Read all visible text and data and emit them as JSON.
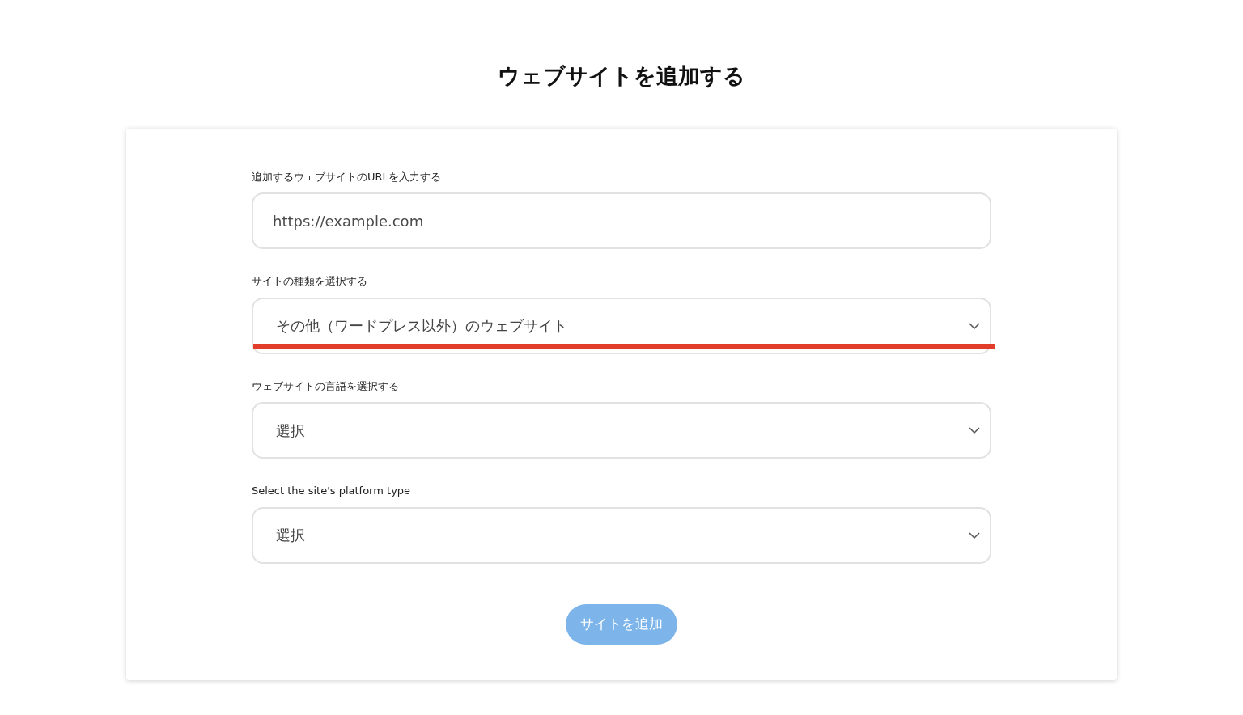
{
  "title": "ウェブサイトを追加する",
  "fields": [
    {
      "kind": "text",
      "label": "追加するウェブサイトのURLを入力する",
      "placeholder": "https://example.com",
      "highlighted": false
    },
    {
      "kind": "select",
      "label": "サイトの種類を選択する",
      "value": "その他（ワードプレス以外）のウェブサイト",
      "highlighted": true
    },
    {
      "kind": "select",
      "label": "ウェブサイトの言語を選択する",
      "value": "選択",
      "highlighted": false
    },
    {
      "kind": "select",
      "label": "Select the site's platform type",
      "value": "選択",
      "highlighted": false
    }
  ],
  "submit": {
    "label": "サイトを追加",
    "disabled": true
  }
}
